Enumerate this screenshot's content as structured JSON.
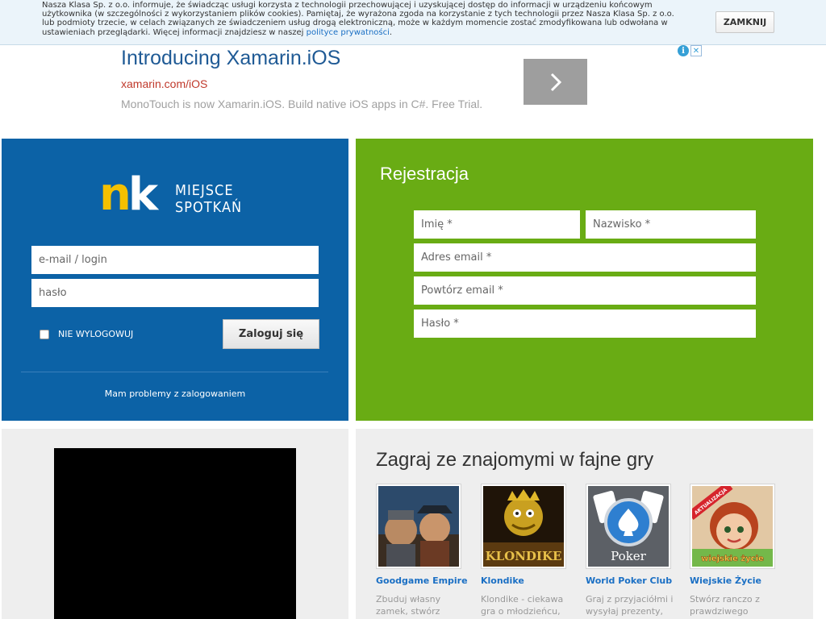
{
  "cookie": {
    "text": "Nasza Klasa Sp. z o.o. informuje, że świadcząc usługi korzysta z technologii przechowującej i uzyskującej dostęp do informacji w urządzeniu końcowym użytkownika (w szczególności z wykorzystaniem plików cookies). Pamiętaj, że wyrażona zgoda na korzystanie z tych technologii przez Nasza Klasa Sp. z o.o. lub podmioty trzecie, w celach związanych ze świadczeniem usług drogą elektroniczną, może w każdym momencie zostać zmodyfikowana lub odwołana w ustawieniach przeglądarki. Więcej informacji znajdziesz w naszej ",
    "link": "polityce prywatności",
    "suffix": ".",
    "close_label": "ZAMKNIJ"
  },
  "ad": {
    "title": "Introducing Xamarin.iOS",
    "url": "xamarin.com/iOS",
    "description": "MonoTouch is now Xamarin.iOS. Build native iOS apps in C#. Free Trial."
  },
  "login": {
    "logo_text": "nk",
    "logo_line1": "MIEJSCE",
    "logo_line2": "SPOTKAŃ",
    "email_placeholder": "e-mail / login",
    "password_placeholder": "hasło",
    "remember_label": "NIE WYLOGOWUJ",
    "submit_label": "Zaloguj się",
    "problem_link": "Mam problemy z zalogowaniem"
  },
  "register": {
    "title": "Rejestracja",
    "first_name": "Imię *",
    "last_name": "Nazwisko *",
    "email": "Adres email *",
    "email_repeat": "Powtórz email *",
    "password": "Hasło *"
  },
  "games": {
    "title": "Zagraj ze znajomymi w fajne gry",
    "items": [
      {
        "name": "Goodgame Empire",
        "desc": "Zbuduj własny zamek, stwórz"
      },
      {
        "name": "Klondike",
        "desc": "Klondike - ciekawa gra o młodzieńcu,"
      },
      {
        "name": "World Poker Club",
        "desc": "Graj z przyjaciółmi i wysyłaj prezenty,"
      },
      {
        "name": "Wiejskie Życie",
        "desc": "Stwórz ranczo z prawdziwego"
      }
    ],
    "thumb_labels": {
      "klondike": "KLONDIKE",
      "poker": "Poker",
      "update_badge": "AKTUALIZACJA",
      "wiejskie": "wiejskie życie"
    }
  }
}
